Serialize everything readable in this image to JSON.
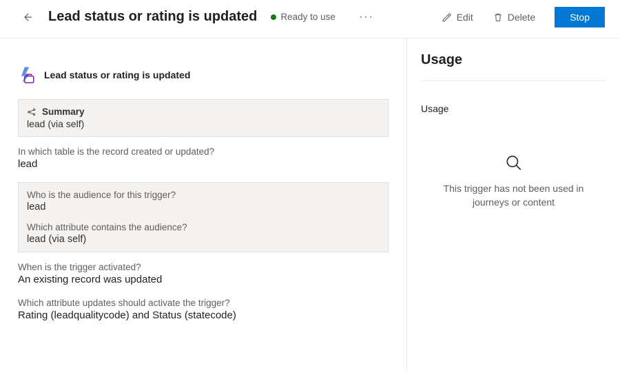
{
  "header": {
    "title": "Lead status or rating is updated",
    "status_label": "Ready to use",
    "edit_label": "Edit",
    "delete_label": "Delete",
    "stop_label": "Stop"
  },
  "main": {
    "trigger_title": "Lead status or rating is updated",
    "summary": {
      "label": "Summary",
      "value": "lead (via self)"
    },
    "table_field": {
      "label": "In which table is the record created or updated?",
      "value": "lead"
    },
    "audience": {
      "label": "Who is the audience for this trigger?",
      "value": "lead",
      "attr_label": "Which attribute contains the audience?",
      "attr_value": "lead (via self)"
    },
    "activation": {
      "label": "When is the trigger activated?",
      "value": "An existing record was updated"
    },
    "attributes": {
      "label": "Which attribute updates should activate the trigger?",
      "value": "Rating (leadqualitycode) and Status (statecode)"
    }
  },
  "side": {
    "title": "Usage",
    "subtitle": "Usage",
    "empty_text": "This trigger has not been used in journeys or content"
  }
}
